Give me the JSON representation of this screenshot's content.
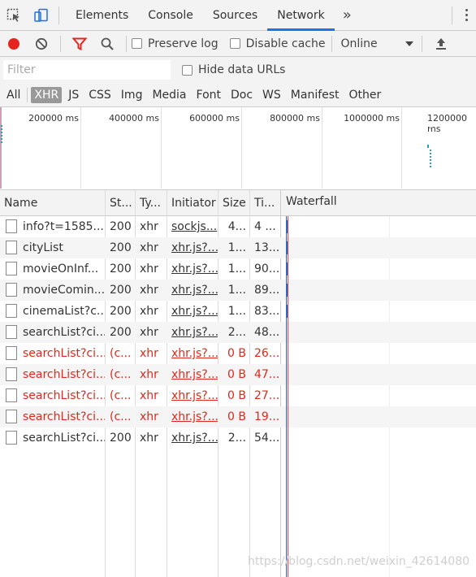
{
  "tabs": [
    {
      "label": "Elements"
    },
    {
      "label": "Console"
    },
    {
      "label": "Sources"
    },
    {
      "label": "Network"
    }
  ],
  "active_tab": "Network",
  "more_tabs_icon": "»",
  "toolbar": {
    "preserve_log_label": "Preserve log",
    "disable_cache_label": "Disable cache",
    "throttling_value": "Online"
  },
  "filter": {
    "placeholder": "Filter",
    "hide_data_urls_label": "Hide data URLs"
  },
  "type_filters": [
    "All",
    "XHR",
    "JS",
    "CSS",
    "Img",
    "Media",
    "Font",
    "Doc",
    "WS",
    "Manifest",
    "Other"
  ],
  "active_type_filter": "XHR",
  "overview": {
    "tick_labels": [
      "200000 ms",
      "400000 ms",
      "600000 ms",
      "800000 ms",
      "1000000 ms",
      "1200000 ms"
    ]
  },
  "columns": {
    "name": "Name",
    "status": "St...",
    "type": "Ty...",
    "initiator": "Initiator",
    "size": "Size",
    "time": "Ti...",
    "waterfall": "Waterfall"
  },
  "rows": [
    {
      "name": "info?t=1585...",
      "status": "200",
      "type": "xhr",
      "initiator": "sockjs...",
      "size": "4...",
      "time": "4 ...",
      "error": false
    },
    {
      "name": "cityList",
      "status": "200",
      "type": "xhr",
      "initiator": "xhr.js?...",
      "size": "1...",
      "time": "13...",
      "error": false
    },
    {
      "name": "movieOnInf...",
      "status": "200",
      "type": "xhr",
      "initiator": "xhr.js?...",
      "size": "1...",
      "time": "90...",
      "error": false
    },
    {
      "name": "movieComin...",
      "status": "200",
      "type": "xhr",
      "initiator": "xhr.js?...",
      "size": "1...",
      "time": "89...",
      "error": false
    },
    {
      "name": "cinemaList?c...",
      "status": "200",
      "type": "xhr",
      "initiator": "xhr.js?...",
      "size": "1...",
      "time": "83...",
      "error": false
    },
    {
      "name": "searchList?ci...",
      "status": "200",
      "type": "xhr",
      "initiator": "xhr.js?...",
      "size": "2...",
      "time": "48...",
      "error": false
    },
    {
      "name": "searchList?ci...",
      "status": "(c...",
      "type": "xhr",
      "initiator": "xhr.js?...",
      "size": "0 B",
      "time": "26...",
      "error": true
    },
    {
      "name": "searchList?ci...",
      "status": "(c...",
      "type": "xhr",
      "initiator": "xhr.js?...",
      "size": "0 B",
      "time": "47...",
      "error": true
    },
    {
      "name": "searchList?ci...",
      "status": "(c...",
      "type": "xhr",
      "initiator": "xhr.js?...",
      "size": "0 B",
      "time": "27...",
      "error": true
    },
    {
      "name": "searchList?ci...",
      "status": "(c...",
      "type": "xhr",
      "initiator": "xhr.js?...",
      "size": "0 B",
      "time": "19...",
      "error": true
    },
    {
      "name": "searchList?ci...",
      "status": "200",
      "type": "xhr",
      "initiator": "xhr.js?...",
      "size": "2...",
      "time": "54...",
      "error": false
    }
  ],
  "watermark": "https://blog.csdn.net/weixin_42614080",
  "colors": {
    "accent": "#1a73e8",
    "record": "#e52420",
    "filter_funnel": "#e52420",
    "error_text": "#e0281d",
    "waterfall_bar": "#2e67c4"
  }
}
